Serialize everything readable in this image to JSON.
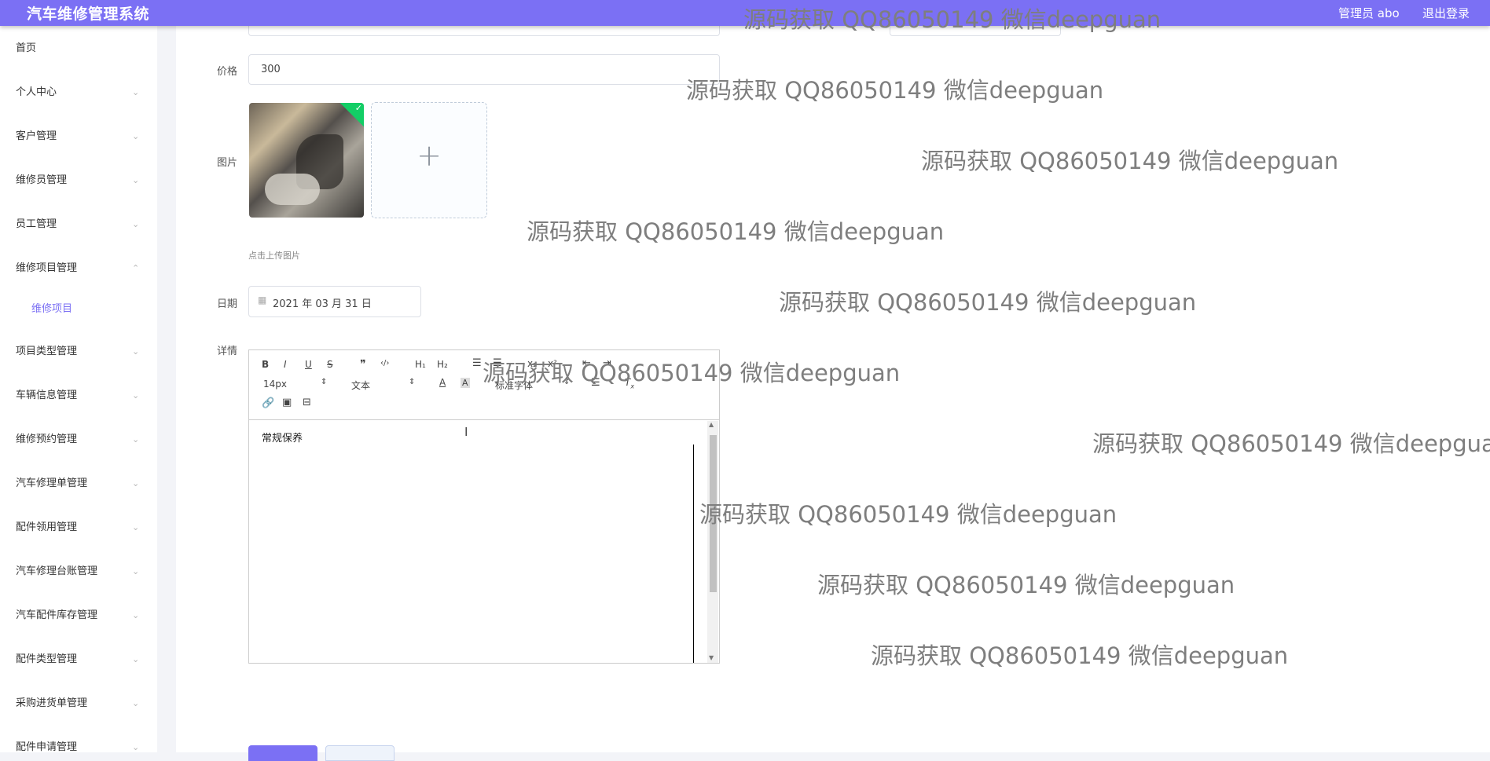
{
  "app": {
    "title": "汽车维修管理系统",
    "user": "管理员 abo",
    "logout": "退出登录"
  },
  "sidebar": {
    "items": [
      {
        "label": "首页"
      },
      {
        "label": "个人中心"
      },
      {
        "label": "客户管理"
      },
      {
        "label": "维修员管理"
      },
      {
        "label": "员工管理"
      },
      {
        "label": "维修项目管理"
      },
      {
        "label": "维修项目"
      },
      {
        "label": "项目类型管理"
      },
      {
        "label": "车辆信息管理"
      },
      {
        "label": "维修预约管理"
      },
      {
        "label": "汽车修理单管理"
      },
      {
        "label": "配件领用管理"
      },
      {
        "label": "汽车修理台账管理"
      },
      {
        "label": "汽车配件库存管理"
      },
      {
        "label": "配件类型管理"
      },
      {
        "label": "采购进货单管理"
      },
      {
        "label": "配件申请管理"
      }
    ]
  },
  "form": {
    "price_label": "价格",
    "price_value": "300",
    "image_label": "图片",
    "upload_plus": "+",
    "upload_hint": "点击上传图片",
    "date_label": "日期",
    "date_value": "2021 年 03 月 31 日",
    "detail_label": "详情"
  },
  "editor": {
    "font_size": "14px",
    "header_select": "文本",
    "font_select": "标准字体",
    "content": "常规保养",
    "tools": {
      "bold": "B",
      "italic": "I",
      "underline": "U",
      "strike": "S",
      "quote": "❞",
      "code": "‹/›",
      "h1": "H₁",
      "h2": "H₂",
      "clean": "T"
    }
  },
  "watermark": "源码获取 QQ86050149 微信deepguan"
}
